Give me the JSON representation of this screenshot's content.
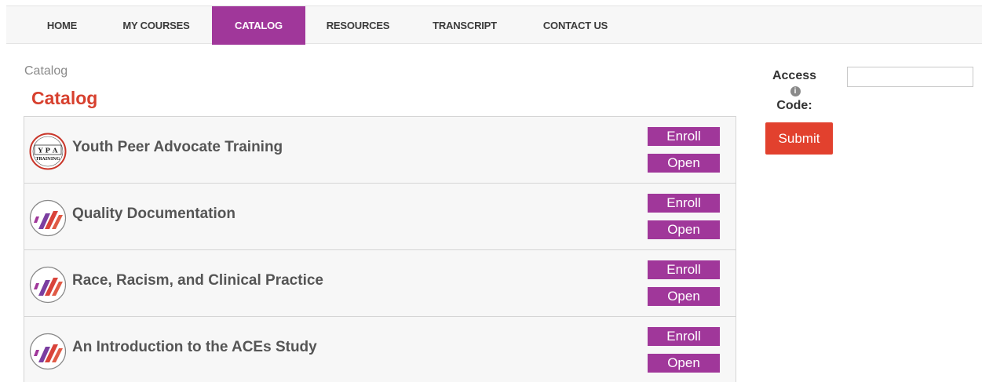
{
  "nav": {
    "items": [
      {
        "label": "HOME",
        "active": false
      },
      {
        "label": "MY COURSES",
        "active": false
      },
      {
        "label": "CATALOG",
        "active": true
      },
      {
        "label": "RESOURCES",
        "active": false
      },
      {
        "label": "TRANSCRIPT",
        "active": false
      },
      {
        "label": "CONTACT US",
        "active": false
      }
    ]
  },
  "breadcrumb": "Catalog",
  "title": "Catalog",
  "courses": [
    {
      "title": "Youth Peer Advocate Training",
      "icon": "ypa-training-logo",
      "logo_text": "Y P A TRAINING",
      "enroll_label": "Enroll",
      "open_label": "Open"
    },
    {
      "title": "Quality Documentation",
      "icon": "stripes-logo",
      "enroll_label": "Enroll",
      "open_label": "Open"
    },
    {
      "title": "Race, Racism, and Clinical Practice",
      "icon": "stripes-logo",
      "enroll_label": "Enroll",
      "open_label": "Open"
    },
    {
      "title": "An Introduction to the ACEs Study",
      "icon": "stripes-logo",
      "enroll_label": "Enroll",
      "open_label": "Open"
    }
  ],
  "access": {
    "label_line1": "Access",
    "label_line2": "Code:",
    "info_icon": "i",
    "value": "",
    "submit_label": "Submit"
  },
  "colors": {
    "accent": "#a0379a",
    "title_red": "#d7402e",
    "submit_red": "#e2412e"
  }
}
